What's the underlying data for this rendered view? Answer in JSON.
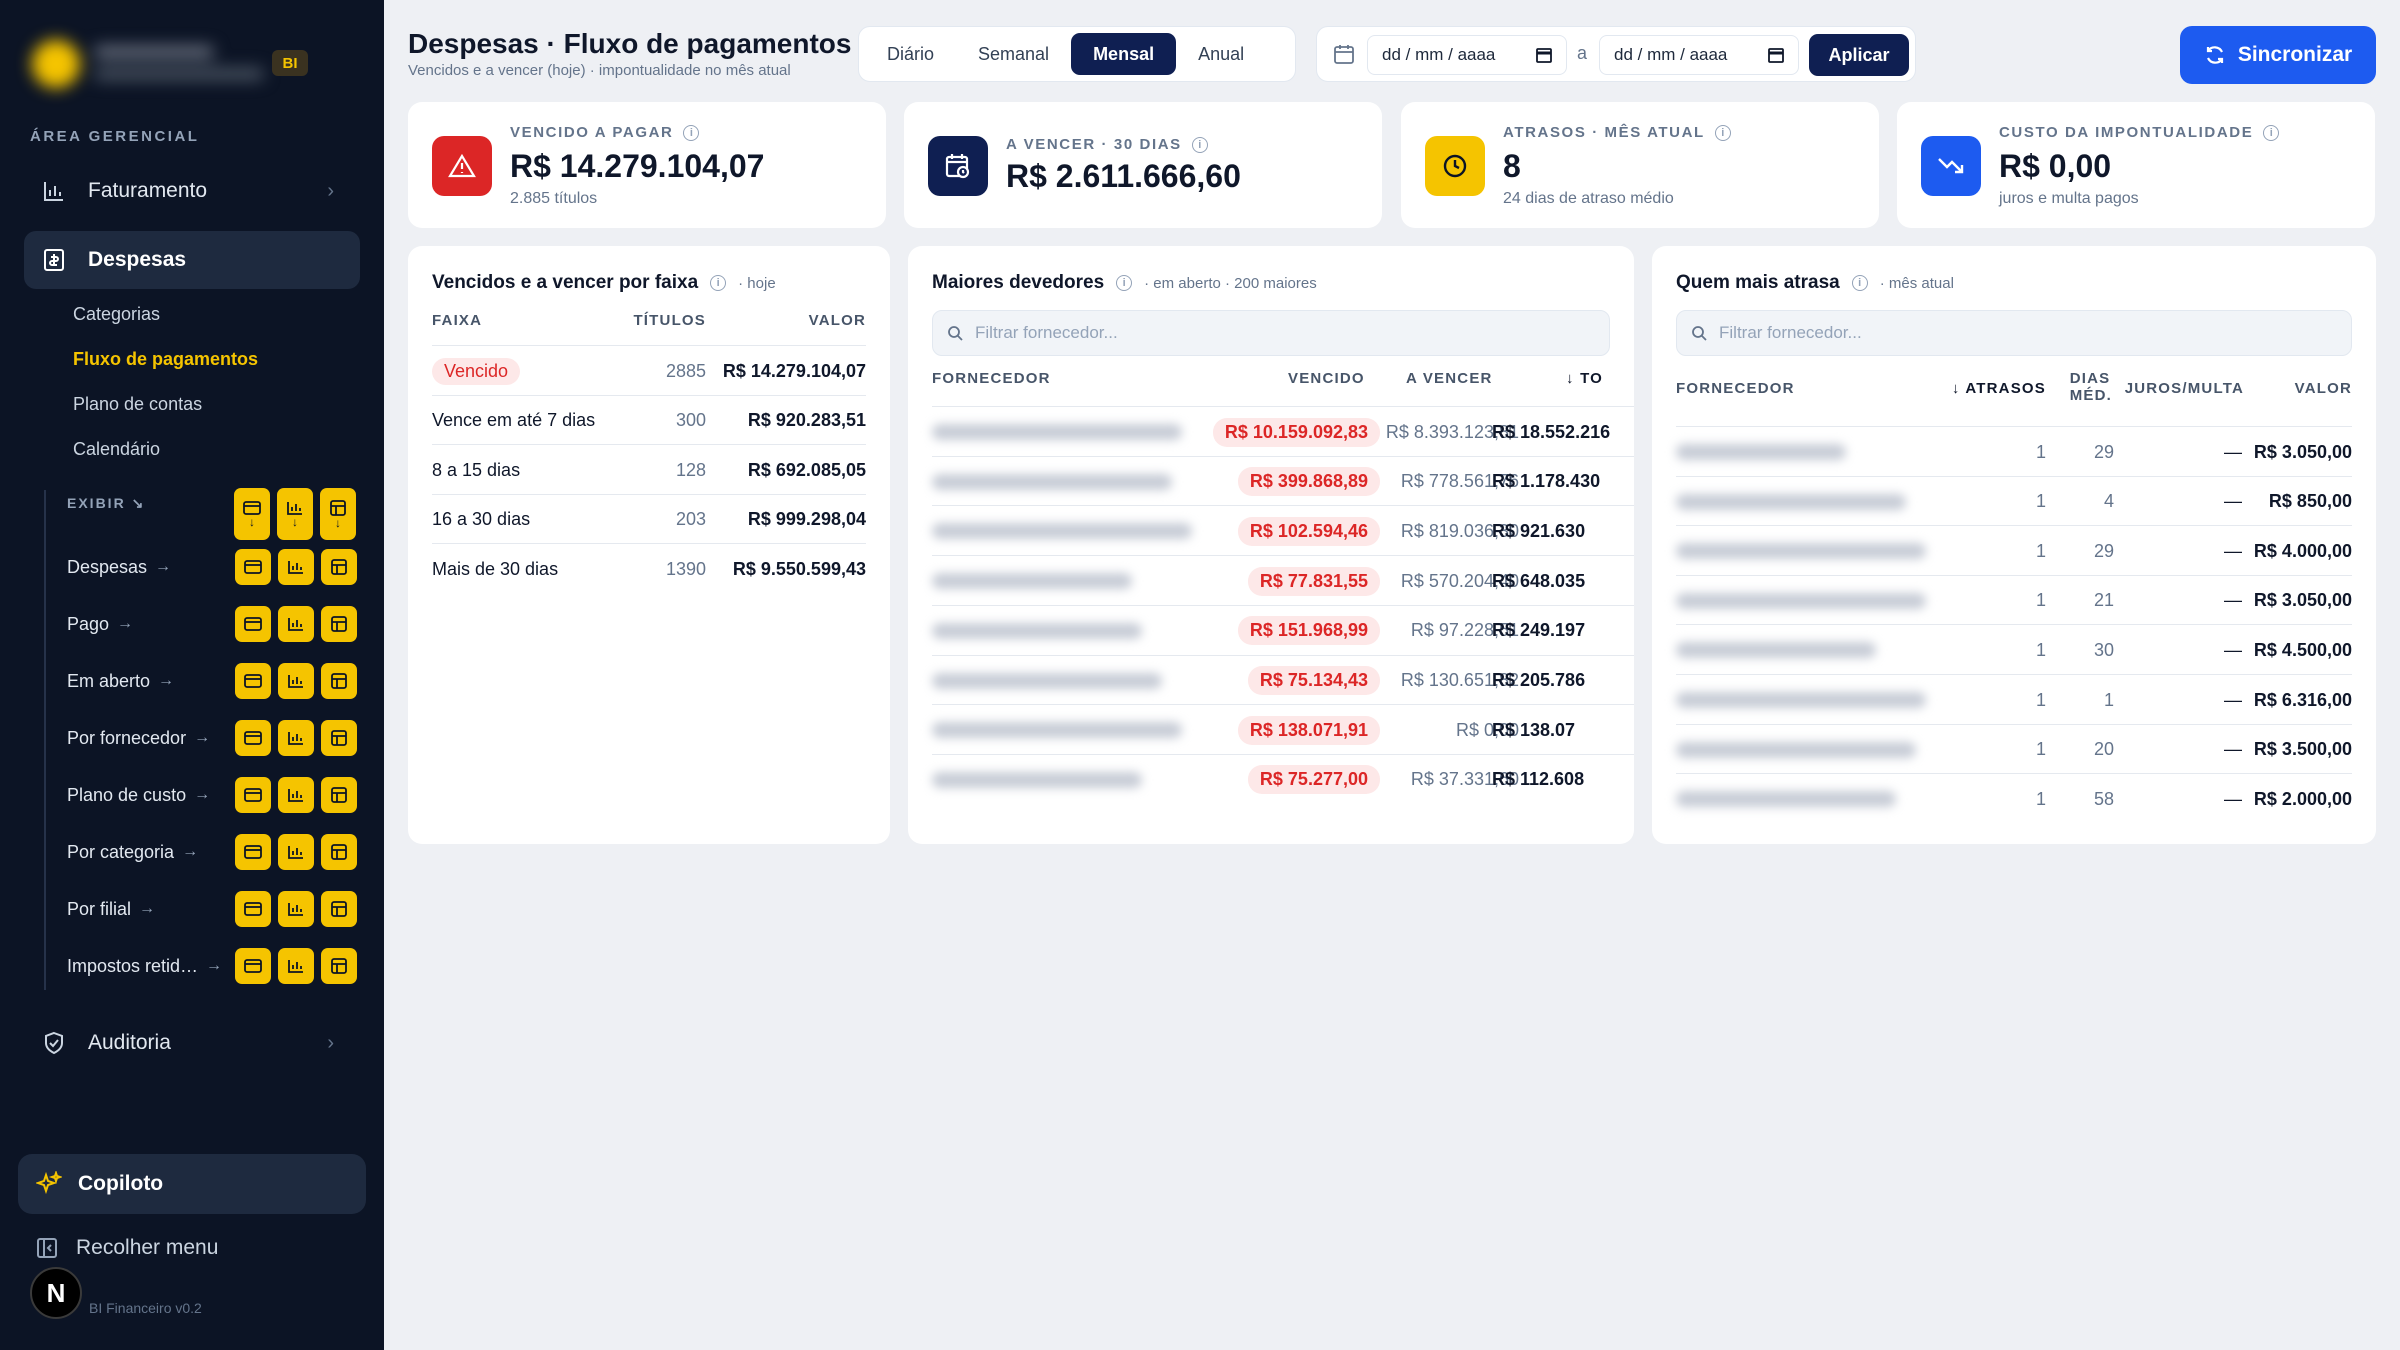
{
  "sidebar": {
    "badge": "BI",
    "section_label": "ÁREA GERENCIAL",
    "nav": {
      "faturamento": "Faturamento",
      "despesas": "Despesas",
      "auditoria": "Auditoria"
    },
    "sub_items": [
      "Categorias",
      "Fluxo de pagamentos",
      "Plano de contas",
      "Calendário"
    ],
    "exibir_label": "EXIBIR",
    "exibir_rows": [
      "Despesas",
      "Pago",
      "Em aberto",
      "Por fornecedor",
      "Plano de custo",
      "Por categoria",
      "Por filial",
      "Impostos retid…"
    ],
    "copiloto": "Copiloto",
    "recolher": "Recolher menu",
    "avatar": "N",
    "version": "BI Financeiro v0.2"
  },
  "header": {
    "title": "Despesas · Fluxo de pagamentos",
    "subtitle": "Vencidos e a vencer (hoje) · impontualidade no mês atual",
    "periods": [
      "Diário",
      "Semanal",
      "Mensal",
      "Anual"
    ],
    "active_period": "Mensal",
    "date_from_placeholder": "dd / mm / aaaa",
    "date_to_placeholder": "dd / mm / aaaa",
    "date_sep": "a",
    "apply": "Aplicar",
    "sync": "Sincronizar"
  },
  "kpis": [
    {
      "label": "VENCIDO A PAGAR",
      "value": "R$ 14.279.104,07",
      "sub": "2.885 títulos",
      "icon": "warning-icon",
      "color": "#dc2626"
    },
    {
      "label": "A VENCER · 30 DIAS",
      "value": "R$ 2.611.666,60",
      "sub": "",
      "icon": "calendar-clock-icon",
      "color": "#0f1f52"
    },
    {
      "label": "ATRASOS · MÊS ATUAL",
      "value": "8",
      "sub": "24 dias de atraso médio",
      "icon": "clock-icon",
      "color": "#f5c400"
    },
    {
      "label": "CUSTO DA IMPONTUALIDADE",
      "value": "R$ 0,00",
      "sub": "juros e multa pagos",
      "icon": "trending-down-icon",
      "color": "#1d5bf0"
    }
  ],
  "faixa": {
    "title": "Vencidos e a vencer por faixa",
    "note": "· hoje",
    "columns": [
      "FAIXA",
      "TÍTULOS",
      "VALOR"
    ],
    "rows": [
      {
        "faixa": "Vencido",
        "titulos": "2885",
        "valor": "R$ 14.279.104,07"
      },
      {
        "faixa": "Vence em até 7 dias",
        "titulos": "300",
        "valor": "R$ 920.283,51"
      },
      {
        "faixa": "8 a 15 dias",
        "titulos": "128",
        "valor": "R$ 692.085,05"
      },
      {
        "faixa": "16 a 30 dias",
        "titulos": "203",
        "valor": "R$ 999.298,04"
      },
      {
        "faixa": "Mais de 30 dias",
        "titulos": "1390",
        "valor": "R$ 9.550.599,43"
      }
    ]
  },
  "devedores": {
    "title": "Maiores devedores",
    "note": "· em aberto · 200 maiores",
    "filter_placeholder": "Filtrar fornecedor...",
    "columns": [
      "FORNECEDOR",
      "VENCIDO",
      "A VENCER",
      "↓ TO"
    ],
    "rows": [
      {
        "vencido": "R$ 10.159.092,83",
        "a_vencer": "R$ 8.393.123,81",
        "total": "R$ 18.552.216"
      },
      {
        "vencido": "R$ 399.868,89",
        "a_vencer": "R$ 778.561,76",
        "total": "R$ 1.178.430"
      },
      {
        "vencido": "R$ 102.594,46",
        "a_vencer": "R$ 819.036,30",
        "total": "R$ 921.630"
      },
      {
        "vencido": "R$ 77.831,55",
        "a_vencer": "R$ 570.204,40",
        "total": "R$ 648.035"
      },
      {
        "vencido": "R$ 151.968,99",
        "a_vencer": "R$ 97.228,51",
        "total": "R$ 249.197"
      },
      {
        "vencido": "R$ 75.134,43",
        "a_vencer": "R$ 130.651,82",
        "total": "R$ 205.786"
      },
      {
        "vencido": "R$ 138.071,91",
        "a_vencer": "R$ 0,00",
        "total": "R$ 138.07"
      },
      {
        "vencido": "R$ 75.277,00",
        "a_vencer": "R$ 37.331,60",
        "total": "R$ 112.608"
      }
    ]
  },
  "atrasa": {
    "title": "Quem mais atrasa",
    "note": "· mês atual",
    "filter_placeholder": "Filtrar fornecedor...",
    "columns": {
      "fornecedor": "FORNECEDOR",
      "atrasos": "↓ ATRASOS",
      "dias_1": "DIAS",
      "dias_2": "MÉD.",
      "juros": "JUROS/MULTA",
      "valor": "VALOR"
    },
    "rows": [
      {
        "atrasos": "1",
        "dias": "29",
        "juros": "—",
        "valor": "R$ 3.050,00"
      },
      {
        "atrasos": "1",
        "dias": "4",
        "juros": "—",
        "valor": "R$ 850,00"
      },
      {
        "atrasos": "1",
        "dias": "29",
        "juros": "—",
        "valor": "R$ 4.000,00"
      },
      {
        "atrasos": "1",
        "dias": "21",
        "juros": "—",
        "valor": "R$ 3.050,00"
      },
      {
        "atrasos": "1",
        "dias": "30",
        "juros": "—",
        "valor": "R$ 4.500,00"
      },
      {
        "atrasos": "1",
        "dias": "1",
        "juros": "—",
        "valor": "R$ 6.316,00"
      },
      {
        "atrasos": "1",
        "dias": "20",
        "juros": "—",
        "valor": "R$ 3.500,00"
      },
      {
        "atrasos": "1",
        "dias": "58",
        "juros": "—",
        "valor": "R$ 2.000,00"
      }
    ]
  },
  "colors": {
    "accent_yellow": "#f5c400",
    "navy": "#0f1f52",
    "danger": "#dc2626",
    "blue": "#1d5bf0",
    "sidebar_bg": "#0c1425"
  }
}
